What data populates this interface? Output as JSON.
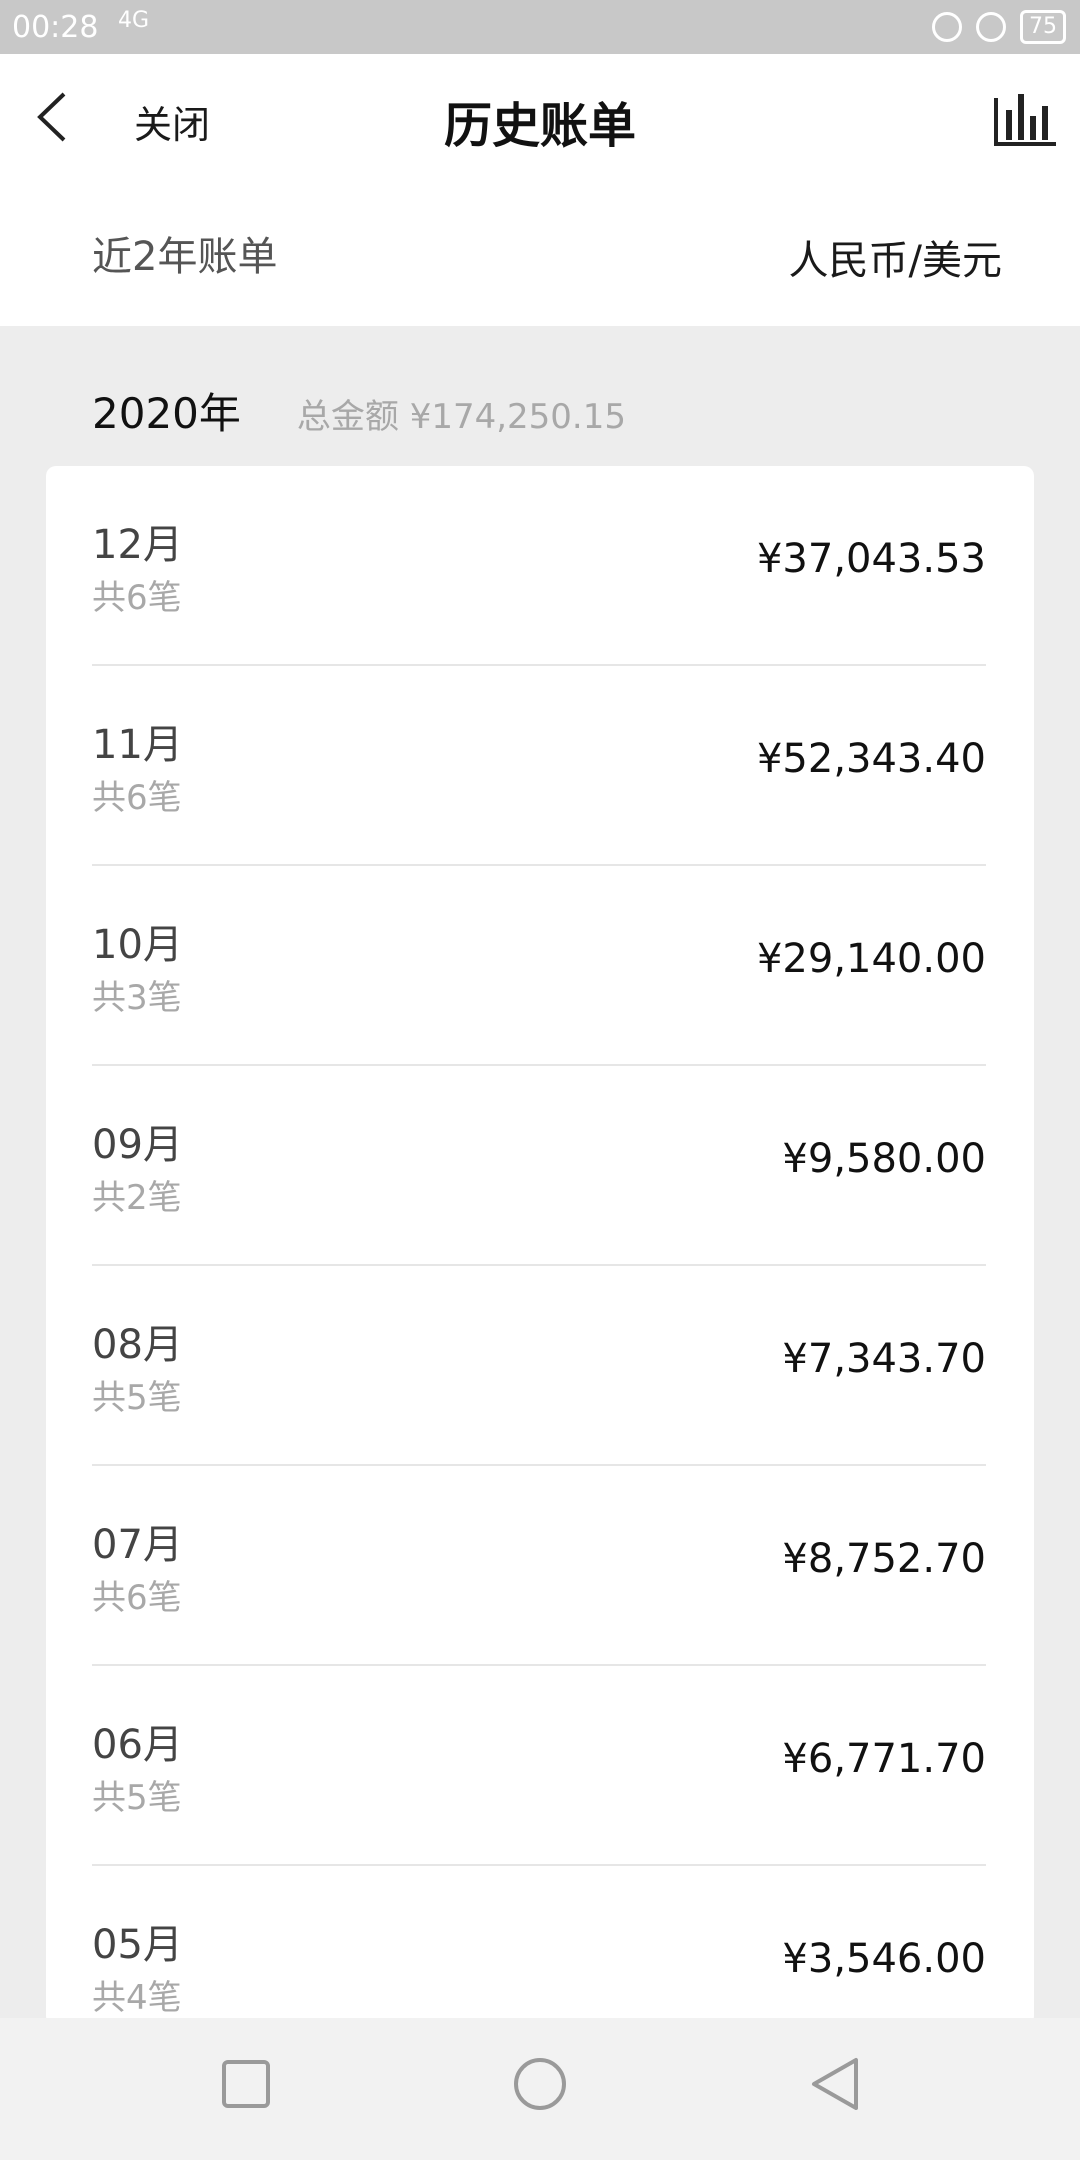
{
  "status_bar": {
    "time": "00:28",
    "signal": "4G",
    "battery": "75"
  },
  "header": {
    "close_label": "关闭",
    "title": "历史账单"
  },
  "filter": {
    "period": "近2年账单",
    "currency": "人民币/美元"
  },
  "year_section": {
    "year": "2020年",
    "total": "总金额 ¥174,250.15"
  },
  "months": [
    {
      "month": "12月",
      "count": "共6笔",
      "amount": "¥37,043.53"
    },
    {
      "month": "11月",
      "count": "共6笔",
      "amount": "¥52,343.40"
    },
    {
      "month": "10月",
      "count": "共3笔",
      "amount": "¥29,140.00"
    },
    {
      "month": "09月",
      "count": "共2笔",
      "amount": "¥9,580.00"
    },
    {
      "month": "08月",
      "count": "共5笔",
      "amount": "¥7,343.70"
    },
    {
      "month": "07月",
      "count": "共6笔",
      "amount": "¥8,752.70"
    },
    {
      "month": "06月",
      "count": "共5笔",
      "amount": "¥6,771.70"
    },
    {
      "month": "05月",
      "count": "共4笔",
      "amount": "¥3,546.00"
    }
  ]
}
